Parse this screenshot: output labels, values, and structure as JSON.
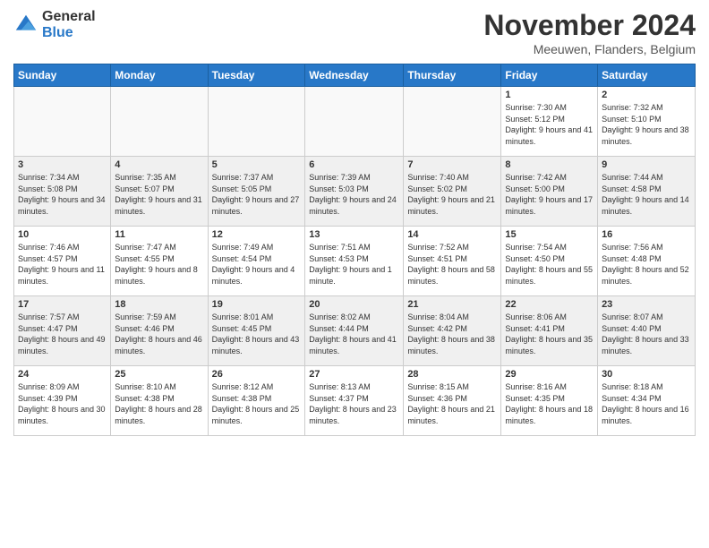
{
  "logo": {
    "general": "General",
    "blue": "Blue"
  },
  "header": {
    "month": "November 2024",
    "location": "Meeuwen, Flanders, Belgium"
  },
  "weekdays": [
    "Sunday",
    "Monday",
    "Tuesday",
    "Wednesday",
    "Thursday",
    "Friday",
    "Saturday"
  ],
  "weeks": [
    [
      {
        "day": "",
        "info": ""
      },
      {
        "day": "",
        "info": ""
      },
      {
        "day": "",
        "info": ""
      },
      {
        "day": "",
        "info": ""
      },
      {
        "day": "",
        "info": ""
      },
      {
        "day": "1",
        "info": "Sunrise: 7:30 AM\nSunset: 5:12 PM\nDaylight: 9 hours and 41 minutes."
      },
      {
        "day": "2",
        "info": "Sunrise: 7:32 AM\nSunset: 5:10 PM\nDaylight: 9 hours and 38 minutes."
      }
    ],
    [
      {
        "day": "3",
        "info": "Sunrise: 7:34 AM\nSunset: 5:08 PM\nDaylight: 9 hours and 34 minutes."
      },
      {
        "day": "4",
        "info": "Sunrise: 7:35 AM\nSunset: 5:07 PM\nDaylight: 9 hours and 31 minutes."
      },
      {
        "day": "5",
        "info": "Sunrise: 7:37 AM\nSunset: 5:05 PM\nDaylight: 9 hours and 27 minutes."
      },
      {
        "day": "6",
        "info": "Sunrise: 7:39 AM\nSunset: 5:03 PM\nDaylight: 9 hours and 24 minutes."
      },
      {
        "day": "7",
        "info": "Sunrise: 7:40 AM\nSunset: 5:02 PM\nDaylight: 9 hours and 21 minutes."
      },
      {
        "day": "8",
        "info": "Sunrise: 7:42 AM\nSunset: 5:00 PM\nDaylight: 9 hours and 17 minutes."
      },
      {
        "day": "9",
        "info": "Sunrise: 7:44 AM\nSunset: 4:58 PM\nDaylight: 9 hours and 14 minutes."
      }
    ],
    [
      {
        "day": "10",
        "info": "Sunrise: 7:46 AM\nSunset: 4:57 PM\nDaylight: 9 hours and 11 minutes."
      },
      {
        "day": "11",
        "info": "Sunrise: 7:47 AM\nSunset: 4:55 PM\nDaylight: 9 hours and 8 minutes."
      },
      {
        "day": "12",
        "info": "Sunrise: 7:49 AM\nSunset: 4:54 PM\nDaylight: 9 hours and 4 minutes."
      },
      {
        "day": "13",
        "info": "Sunrise: 7:51 AM\nSunset: 4:53 PM\nDaylight: 9 hours and 1 minute."
      },
      {
        "day": "14",
        "info": "Sunrise: 7:52 AM\nSunset: 4:51 PM\nDaylight: 8 hours and 58 minutes."
      },
      {
        "day": "15",
        "info": "Sunrise: 7:54 AM\nSunset: 4:50 PM\nDaylight: 8 hours and 55 minutes."
      },
      {
        "day": "16",
        "info": "Sunrise: 7:56 AM\nSunset: 4:48 PM\nDaylight: 8 hours and 52 minutes."
      }
    ],
    [
      {
        "day": "17",
        "info": "Sunrise: 7:57 AM\nSunset: 4:47 PM\nDaylight: 8 hours and 49 minutes."
      },
      {
        "day": "18",
        "info": "Sunrise: 7:59 AM\nSunset: 4:46 PM\nDaylight: 8 hours and 46 minutes."
      },
      {
        "day": "19",
        "info": "Sunrise: 8:01 AM\nSunset: 4:45 PM\nDaylight: 8 hours and 43 minutes."
      },
      {
        "day": "20",
        "info": "Sunrise: 8:02 AM\nSunset: 4:44 PM\nDaylight: 8 hours and 41 minutes."
      },
      {
        "day": "21",
        "info": "Sunrise: 8:04 AM\nSunset: 4:42 PM\nDaylight: 8 hours and 38 minutes."
      },
      {
        "day": "22",
        "info": "Sunrise: 8:06 AM\nSunset: 4:41 PM\nDaylight: 8 hours and 35 minutes."
      },
      {
        "day": "23",
        "info": "Sunrise: 8:07 AM\nSunset: 4:40 PM\nDaylight: 8 hours and 33 minutes."
      }
    ],
    [
      {
        "day": "24",
        "info": "Sunrise: 8:09 AM\nSunset: 4:39 PM\nDaylight: 8 hours and 30 minutes."
      },
      {
        "day": "25",
        "info": "Sunrise: 8:10 AM\nSunset: 4:38 PM\nDaylight: 8 hours and 28 minutes."
      },
      {
        "day": "26",
        "info": "Sunrise: 8:12 AM\nSunset: 4:38 PM\nDaylight: 8 hours and 25 minutes."
      },
      {
        "day": "27",
        "info": "Sunrise: 8:13 AM\nSunset: 4:37 PM\nDaylight: 8 hours and 23 minutes."
      },
      {
        "day": "28",
        "info": "Sunrise: 8:15 AM\nSunset: 4:36 PM\nDaylight: 8 hours and 21 minutes."
      },
      {
        "day": "29",
        "info": "Sunrise: 8:16 AM\nSunset: 4:35 PM\nDaylight: 8 hours and 18 minutes."
      },
      {
        "day": "30",
        "info": "Sunrise: 8:18 AM\nSunset: 4:34 PM\nDaylight: 8 hours and 16 minutes."
      }
    ]
  ]
}
